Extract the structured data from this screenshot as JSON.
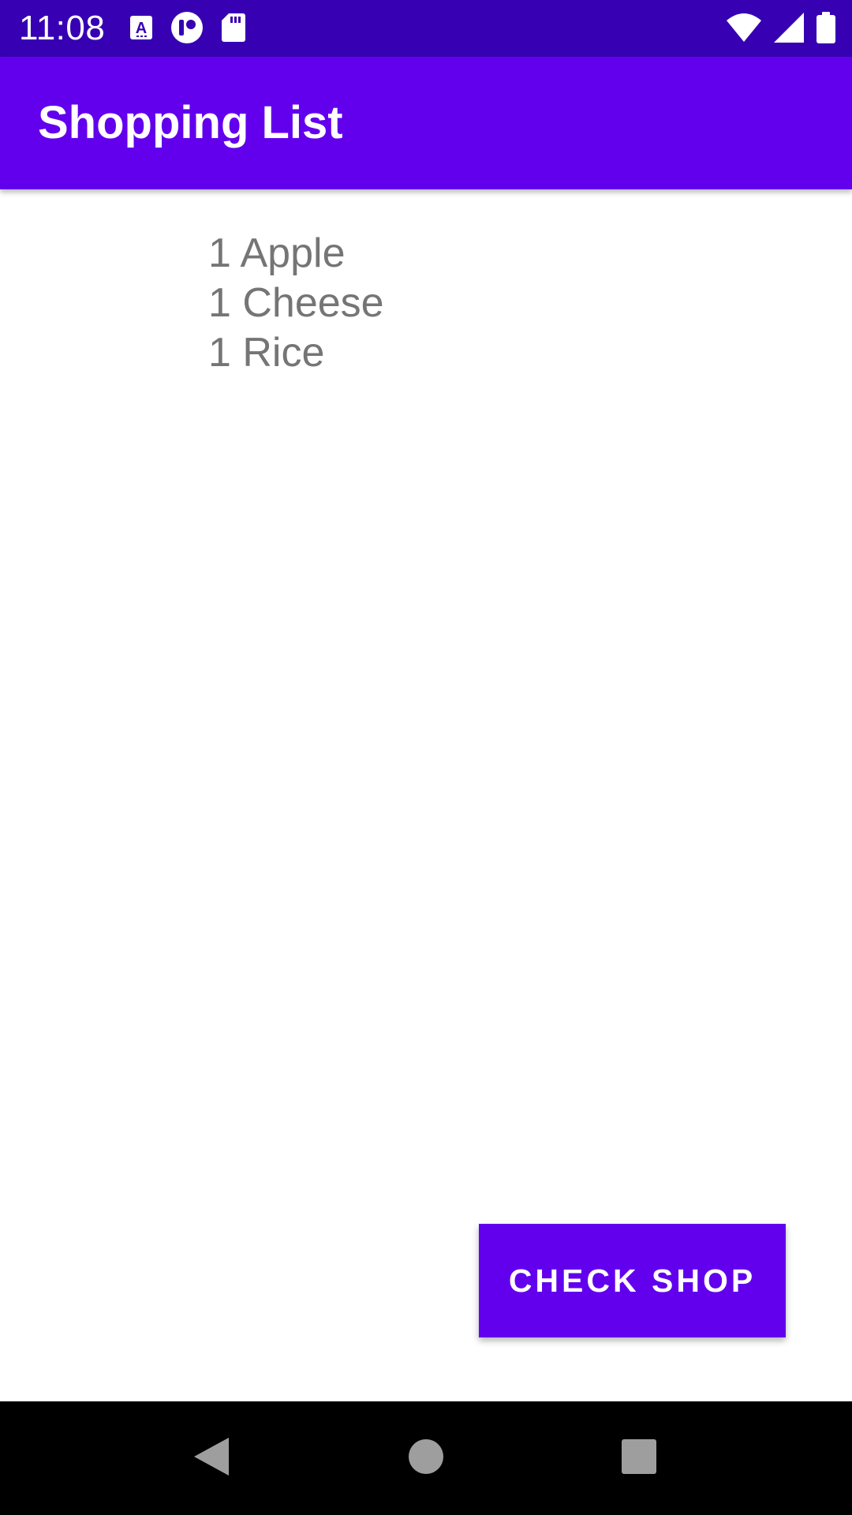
{
  "status_bar": {
    "time": "11:08",
    "left_icons": [
      "keyboard-a-icon",
      "assistant-icon",
      "sd-card-icon"
    ],
    "right_icons": [
      "wifi-icon",
      "cellular-signal-icon",
      "battery-icon"
    ],
    "background_color": "#3700b3"
  },
  "app_bar": {
    "title": "Shopping List",
    "background_color": "#6200ee"
  },
  "shopping_list": {
    "items": [
      {
        "label": "1 Apple"
      },
      {
        "label": "1 Cheese"
      },
      {
        "label": "1 Rice"
      }
    ]
  },
  "actions": {
    "check_shop_label": "CHECK SHOP",
    "accent_color": "#6200ee"
  },
  "nav_bar": {
    "icons": [
      "back-icon",
      "home-icon",
      "recents-icon"
    ]
  }
}
